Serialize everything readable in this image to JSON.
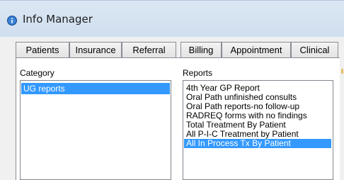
{
  "window": {
    "title": "Info Manager",
    "icon": "info-circle-icon",
    "accent_color": "#3399ff"
  },
  "tabs": [
    {
      "label": "Patients"
    },
    {
      "label": "Insurance"
    },
    {
      "label": "Referral"
    },
    {
      "label": "Billing"
    },
    {
      "label": "Appointment"
    },
    {
      "label": "Clinical"
    }
  ],
  "category": {
    "label": "Category",
    "items": [
      {
        "label": "UG reports",
        "selected": true
      }
    ]
  },
  "reports": {
    "label": "Reports",
    "items": [
      {
        "label": "4th Year GP Report",
        "selected": false
      },
      {
        "label": "Oral Path unfinished consults",
        "selected": false
      },
      {
        "label": "Oral Path reports-no follow-up",
        "selected": false
      },
      {
        "label": "RADREQ forms with no findings",
        "selected": false
      },
      {
        "label": "Total Treatment By Patient",
        "selected": false
      },
      {
        "label": "All P-I-C Treatment by Patient",
        "selected": false
      },
      {
        "label": "All In Process Tx By Patient",
        "selected": true
      }
    ]
  }
}
